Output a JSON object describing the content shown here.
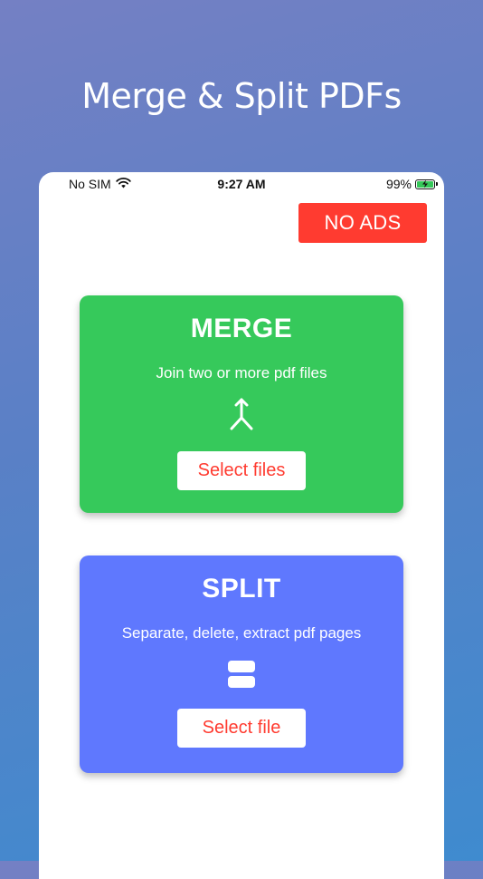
{
  "headline": "Merge & Split PDFs",
  "status_bar": {
    "carrier": "No SIM",
    "time": "9:27 AM",
    "battery_percent": "99%",
    "battery_level": 0.99
  },
  "no_ads_label": "NO ADS",
  "merge": {
    "title": "MERGE",
    "description": "Join two or more pdf files",
    "icon": "merge-arrows-icon",
    "button_label": "Select files"
  },
  "split": {
    "title": "SPLIT",
    "description": "Separate, delete, extract pdf pages",
    "icon": "split-page-icon",
    "button_label": "Select file"
  },
  "colors": {
    "merge_card": "#36c95b",
    "split_card": "#5f78fe",
    "accent_red": "#ff3b30"
  }
}
